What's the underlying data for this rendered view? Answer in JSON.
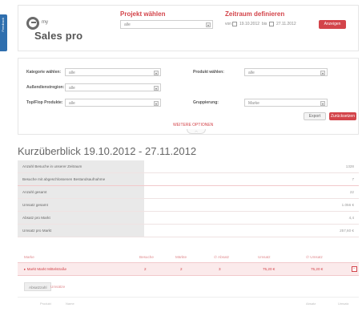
{
  "side_tab": {
    "label": "Feedback"
  },
  "header": {
    "logo_my": "my",
    "logo_name": "Sales pro",
    "project_title": "Projekt wählen",
    "project_value": "alle",
    "period_title": "Zeitraum definieren",
    "date_from_label": "von",
    "date_from": "19.10.2012",
    "date_to_label": "bis",
    "date_to": "27.11.2012",
    "apply_button": "Anzeigen"
  },
  "filters": {
    "category_label": "Kategorie wählen:",
    "category_value": "alle",
    "field_service_label": "Außendienstregion:",
    "field_service_value": "alle",
    "top_flop_label": "Top/Flop Produkte:",
    "top_flop_value": "alle",
    "product_label": "Produkt wählen:",
    "product_value": "alle",
    "grouping_label": "Gruppierung:",
    "grouping_value": "Marke",
    "export_button": "Export",
    "reset_button": "Zurücksetzen",
    "more_filters": "WEITERE OPTIONEN"
  },
  "overview": {
    "title": "Kurzüberblick 19.10.2012 - 27.11.2012",
    "rows": [
      {
        "label": "Anzahl Besuche in unserer Zeitraum",
        "value": "1328",
        "pink": false
      },
      {
        "label": "Besuche mit abgeschlossenen Bestandsaufnahme",
        "value": "7",
        "pink": true
      },
      {
        "label": "Anzahl gesamt",
        "value": "22",
        "pink": false
      },
      {
        "label": "Umsatz gesamt",
        "value": "1.056 €",
        "pink": false
      },
      {
        "label": "Absatz pro Markt",
        "value": "4,4",
        "pink": false
      },
      {
        "label": "Umsatz pro Markt",
        "value": "257,60 €",
        "pink": false
      }
    ]
  },
  "table": {
    "headers": [
      "Marke",
      "Besuche",
      "Märkte",
      "∅ Absatz",
      "Umsatz",
      "∅ Umsatz"
    ],
    "row": [
      "▸ Markt Markt Mittelstraße",
      "2",
      "2",
      "3",
      "75,20 €",
      "75,20 €"
    ],
    "toggle": "−"
  },
  "tabs": {
    "active": "Absatzzahl",
    "inactive": "Umsätze"
  },
  "sub_head": [
    "Produkt",
    "Name",
    "Absatz",
    "Umsatz"
  ]
}
